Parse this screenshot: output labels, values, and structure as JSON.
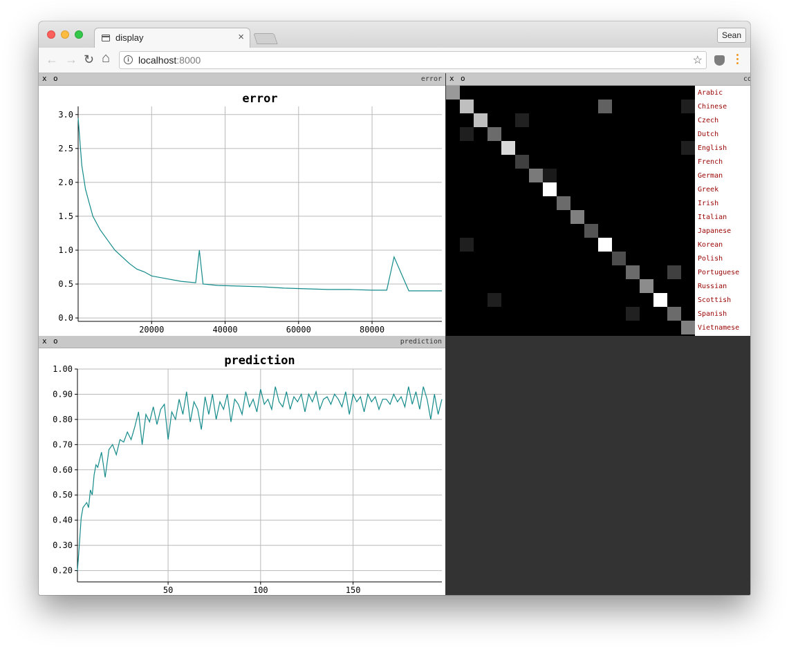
{
  "browser": {
    "tab_title": "display",
    "tab_close": "×",
    "profile": "Sean",
    "url_host": "localhost",
    "url_port": ":8000",
    "back": "←",
    "forward": "→",
    "reload": "↻",
    "home": "⌂",
    "info": "i",
    "star": "☆",
    "icons": [
      "back-arrow-icon",
      "forward-arrow-icon",
      "reload-icon",
      "home-icon",
      "info-icon",
      "star-icon",
      "extension-icon",
      "menu-dots-icon",
      "tab-page-icon"
    ],
    "colors": {
      "close": "#fc605c",
      "minimize": "#fdbc40",
      "maximize": "#34c84a",
      "menu": "#f2961e"
    }
  },
  "panels": {
    "error": {
      "close": "x",
      "option": "o",
      "name": "error"
    },
    "confusion": {
      "close": "x",
      "option": "o",
      "name": "co"
    },
    "prediction": {
      "close": "x",
      "option": "o",
      "name": "prediction"
    }
  },
  "chart_data": [
    {
      "type": "line",
      "title": "error",
      "x_ticks": [
        "20000",
        "40000",
        "60000",
        "80000"
      ],
      "y_ticks": [
        "0.0",
        "0.5",
        "1.0",
        "1.5",
        "2.0",
        "2.5",
        "3.0"
      ],
      "xlim": [
        0,
        99000
      ],
      "ylim": [
        -0.05,
        3.12
      ],
      "grid": true,
      "line_color": "#138a8a",
      "series": [
        {
          "x": [
            0,
            1000,
            2000,
            3000,
            4000,
            6000,
            8000,
            10000,
            12000,
            14000,
            16000,
            18000,
            20000,
            24000,
            28000,
            32000,
            33000,
            34000,
            38000,
            44000,
            50000,
            56000,
            62000,
            68000,
            74000,
            80000,
            84000,
            86000,
            90000,
            94000,
            99000
          ],
          "y": [
            2.95,
            2.25,
            1.9,
            1.7,
            1.5,
            1.3,
            1.15,
            1.0,
            0.9,
            0.8,
            0.72,
            0.68,
            0.62,
            0.58,
            0.54,
            0.52,
            1.0,
            0.5,
            0.48,
            0.47,
            0.46,
            0.44,
            0.43,
            0.42,
            0.42,
            0.41,
            0.41,
            0.9,
            0.4,
            0.4,
            0.4
          ]
        }
      ]
    },
    {
      "type": "heatmap",
      "title": "",
      "labels": [
        "Arabic",
        "Chinese",
        "Czech",
        "Dutch",
        "English",
        "French",
        "German",
        "Greek",
        "Irish",
        "Italian",
        "Japanese",
        "Korean",
        "Polish",
        "Portuguese",
        "Russian",
        "Scottish",
        "Spanish",
        "Vietnamese"
      ],
      "label_color": "#990000",
      "matrix": [
        [
          0.6,
          0,
          0,
          0,
          0,
          0,
          0,
          0,
          0,
          0,
          0,
          0,
          0,
          0,
          0,
          0,
          0,
          0
        ],
        [
          0,
          0.75,
          0,
          0,
          0,
          0,
          0,
          0,
          0,
          0,
          0,
          0.38,
          0,
          0,
          0,
          0,
          0,
          0.12
        ],
        [
          0,
          0,
          0.75,
          0,
          0,
          0.13,
          0,
          0,
          0,
          0,
          0,
          0,
          0,
          0,
          0,
          0,
          0,
          0
        ],
        [
          0,
          0.12,
          0,
          0.42,
          0,
          0,
          0,
          0,
          0,
          0,
          0,
          0,
          0,
          0,
          0,
          0,
          0,
          0
        ],
        [
          0,
          0,
          0,
          0,
          0.85,
          0,
          0,
          0,
          0,
          0,
          0,
          0,
          0,
          0,
          0,
          0,
          0,
          0.12
        ],
        [
          0,
          0,
          0,
          0,
          0,
          0.25,
          0,
          0,
          0,
          0,
          0,
          0,
          0,
          0,
          0,
          0,
          0,
          0
        ],
        [
          0,
          0,
          0,
          0,
          0,
          0,
          0.48,
          0.1,
          0,
          0,
          0,
          0,
          0,
          0,
          0,
          0,
          0,
          0
        ],
        [
          0,
          0,
          0,
          0,
          0,
          0,
          0,
          1.0,
          0,
          0,
          0,
          0,
          0,
          0,
          0,
          0,
          0,
          0
        ],
        [
          0,
          0,
          0,
          0,
          0,
          0,
          0,
          0,
          0.42,
          0,
          0,
          0,
          0,
          0,
          0,
          0,
          0,
          0
        ],
        [
          0,
          0,
          0,
          0,
          0,
          0,
          0,
          0,
          0,
          0.5,
          0,
          0,
          0,
          0,
          0,
          0,
          0,
          0
        ],
        [
          0,
          0,
          0,
          0,
          0,
          0,
          0,
          0,
          0,
          0,
          0.33,
          0,
          0,
          0,
          0,
          0,
          0,
          0
        ],
        [
          0,
          0.12,
          0,
          0,
          0,
          0,
          0,
          0,
          0,
          0,
          0,
          1.0,
          0,
          0,
          0,
          0,
          0,
          0
        ],
        [
          0,
          0,
          0,
          0,
          0,
          0,
          0,
          0,
          0,
          0,
          0,
          0,
          0.3,
          0,
          0,
          0,
          0,
          0
        ],
        [
          0,
          0,
          0,
          0,
          0,
          0,
          0,
          0,
          0,
          0,
          0,
          0,
          0,
          0.42,
          0,
          0,
          0.25,
          0
        ],
        [
          0,
          0,
          0,
          0,
          0,
          0,
          0,
          0,
          0,
          0,
          0,
          0,
          0,
          0,
          0.55,
          0,
          0,
          0
        ],
        [
          0,
          0,
          0,
          0.12,
          0,
          0,
          0,
          0,
          0,
          0,
          0,
          0,
          0,
          0,
          0,
          1.0,
          0,
          0
        ],
        [
          0,
          0,
          0,
          0,
          0,
          0,
          0,
          0,
          0,
          0,
          0,
          0,
          0,
          0.13,
          0,
          0,
          0.42,
          0
        ],
        [
          0,
          0,
          0,
          0,
          0,
          0,
          0,
          0,
          0,
          0,
          0,
          0,
          0,
          0,
          0,
          0,
          0,
          0.5
        ]
      ]
    },
    {
      "type": "line",
      "title": "prediction",
      "x_ticks": [
        "50",
        "100",
        "150"
      ],
      "y_ticks": [
        "0.20",
        "0.30",
        "0.40",
        "0.50",
        "0.60",
        "0.70",
        "0.80",
        "0.90",
        "1.00"
      ],
      "xlim": [
        1,
        198
      ],
      "ylim": [
        0.155,
        1.0
      ],
      "grid": true,
      "line_color": "#138a8a",
      "series": [
        {
          "x": [
            1,
            2,
            3,
            4,
            5,
            6,
            7,
            8,
            9,
            10,
            11,
            12,
            14,
            16,
            18,
            20,
            22,
            24,
            26,
            28,
            30,
            32,
            34,
            36,
            38,
            40,
            42,
            44,
            46,
            48,
            50,
            52,
            54,
            56,
            58,
            60,
            62,
            64,
            66,
            68,
            70,
            72,
            74,
            76,
            78,
            80,
            82,
            84,
            86,
            88,
            90,
            92,
            94,
            96,
            98,
            100,
            102,
            104,
            106,
            108,
            110,
            112,
            114,
            116,
            118,
            120,
            122,
            124,
            126,
            128,
            130,
            132,
            134,
            136,
            138,
            140,
            142,
            144,
            146,
            148,
            150,
            152,
            154,
            156,
            158,
            160,
            162,
            164,
            166,
            168,
            170,
            172,
            174,
            176,
            178,
            180,
            182,
            184,
            186,
            188,
            190,
            192,
            194,
            196,
            198
          ],
          "y": [
            0.2,
            0.3,
            0.41,
            0.45,
            0.46,
            0.47,
            0.45,
            0.52,
            0.5,
            0.58,
            0.62,
            0.61,
            0.67,
            0.57,
            0.68,
            0.7,
            0.66,
            0.72,
            0.71,
            0.75,
            0.72,
            0.77,
            0.83,
            0.7,
            0.82,
            0.79,
            0.85,
            0.78,
            0.84,
            0.86,
            0.72,
            0.83,
            0.8,
            0.88,
            0.82,
            0.91,
            0.79,
            0.87,
            0.84,
            0.76,
            0.89,
            0.82,
            0.9,
            0.8,
            0.87,
            0.84,
            0.9,
            0.79,
            0.88,
            0.86,
            0.82,
            0.91,
            0.85,
            0.88,
            0.83,
            0.92,
            0.86,
            0.88,
            0.84,
            0.93,
            0.87,
            0.85,
            0.91,
            0.84,
            0.89,
            0.87,
            0.9,
            0.83,
            0.9,
            0.87,
            0.91,
            0.84,
            0.88,
            0.89,
            0.86,
            0.9,
            0.88,
            0.85,
            0.91,
            0.82,
            0.9,
            0.87,
            0.89,
            0.83,
            0.9,
            0.87,
            0.89,
            0.84,
            0.88,
            0.88,
            0.86,
            0.9,
            0.87,
            0.89,
            0.85,
            0.93,
            0.86,
            0.91,
            0.84,
            0.93,
            0.88,
            0.8,
            0.9,
            0.82,
            0.88
          ]
        }
      ]
    }
  ]
}
